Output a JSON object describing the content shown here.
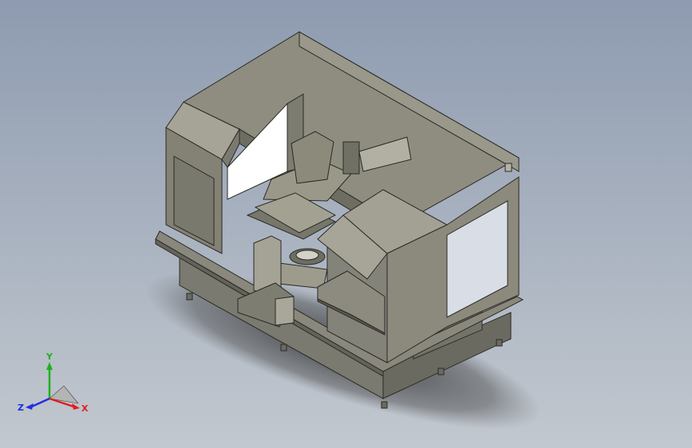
{
  "viewport": {
    "background_top": "#8e9bb0",
    "background_bottom": "#c2c8cf"
  },
  "model": {
    "body_color": "#8e8c7e",
    "shadow_color": "#3c3c3c"
  },
  "triad": {
    "x_label": "X",
    "y_label": "Y",
    "z_label": "Z",
    "x_color": "#e02020",
    "y_color": "#20b020",
    "z_color": "#2030e0"
  }
}
